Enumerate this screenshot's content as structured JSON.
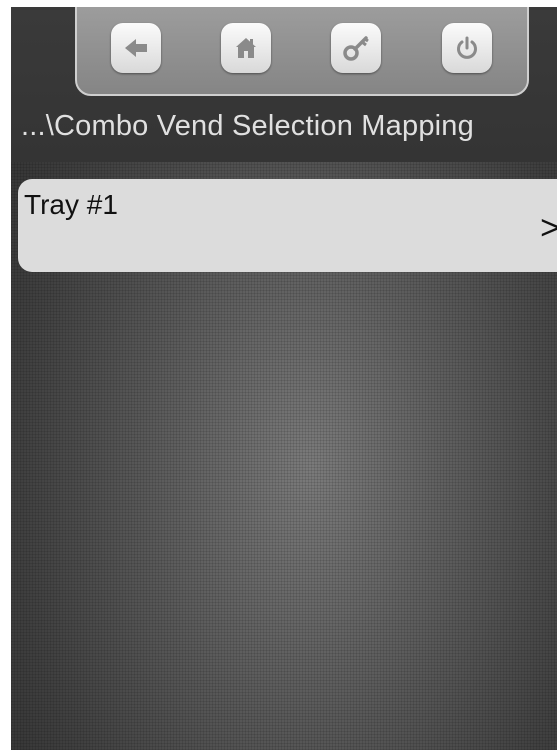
{
  "nav": {
    "buttons": [
      {
        "icon": "back-arrow-icon"
      },
      {
        "icon": "home-icon"
      },
      {
        "icon": "key-icon"
      },
      {
        "icon": "power-icon"
      }
    ]
  },
  "header": {
    "breadcrumb": "...\\Combo Vend Selection Mapping"
  },
  "list": {
    "items": [
      {
        "label": "Tray #1",
        "chevron": ">"
      }
    ]
  },
  "colors": {
    "icon": "#8a8a8a",
    "list_item_bg": "#dcdcdc",
    "header_text": "#e0e0e0"
  }
}
